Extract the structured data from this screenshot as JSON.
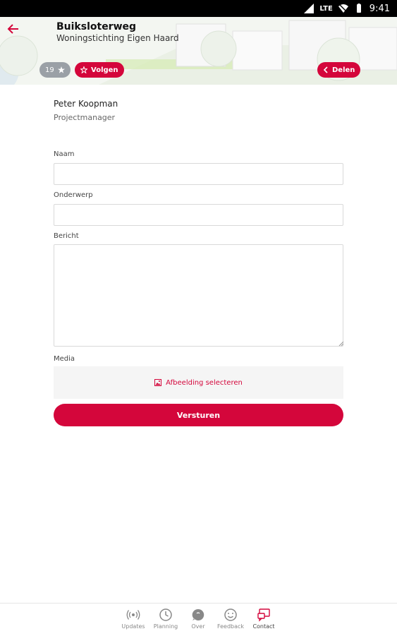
{
  "status_bar": {
    "network": "LTE",
    "time": "9:41"
  },
  "header": {
    "title": "Buiksloterweg",
    "subtitle": "Woningstichting Eigen Haard",
    "follower_count": "19",
    "follow_label": "Volgen",
    "share_label": "Delen"
  },
  "contact": {
    "name": "Peter Koopman",
    "role": "Projectmanager"
  },
  "form": {
    "name_label": "Naam",
    "name_value": "",
    "subject_label": "Onderwerp",
    "subject_value": "",
    "message_label": "Bericht",
    "message_value": "",
    "media_label": "Media",
    "media_button": "Afbeelding selecteren",
    "submit_label": "Versturen"
  },
  "bottom_nav": [
    {
      "label": "Updates",
      "icon": "broadcast-icon"
    },
    {
      "label": "Planning",
      "icon": "clock-icon"
    },
    {
      "label": "Over",
      "icon": "info-bubble-icon"
    },
    {
      "label": "Feedback",
      "icon": "smiley-icon"
    },
    {
      "label": "Contact",
      "icon": "contact-icon",
      "active": true
    }
  ],
  "colors": {
    "accent": "#d4063b",
    "pill_grey": "#9aa0a6"
  }
}
